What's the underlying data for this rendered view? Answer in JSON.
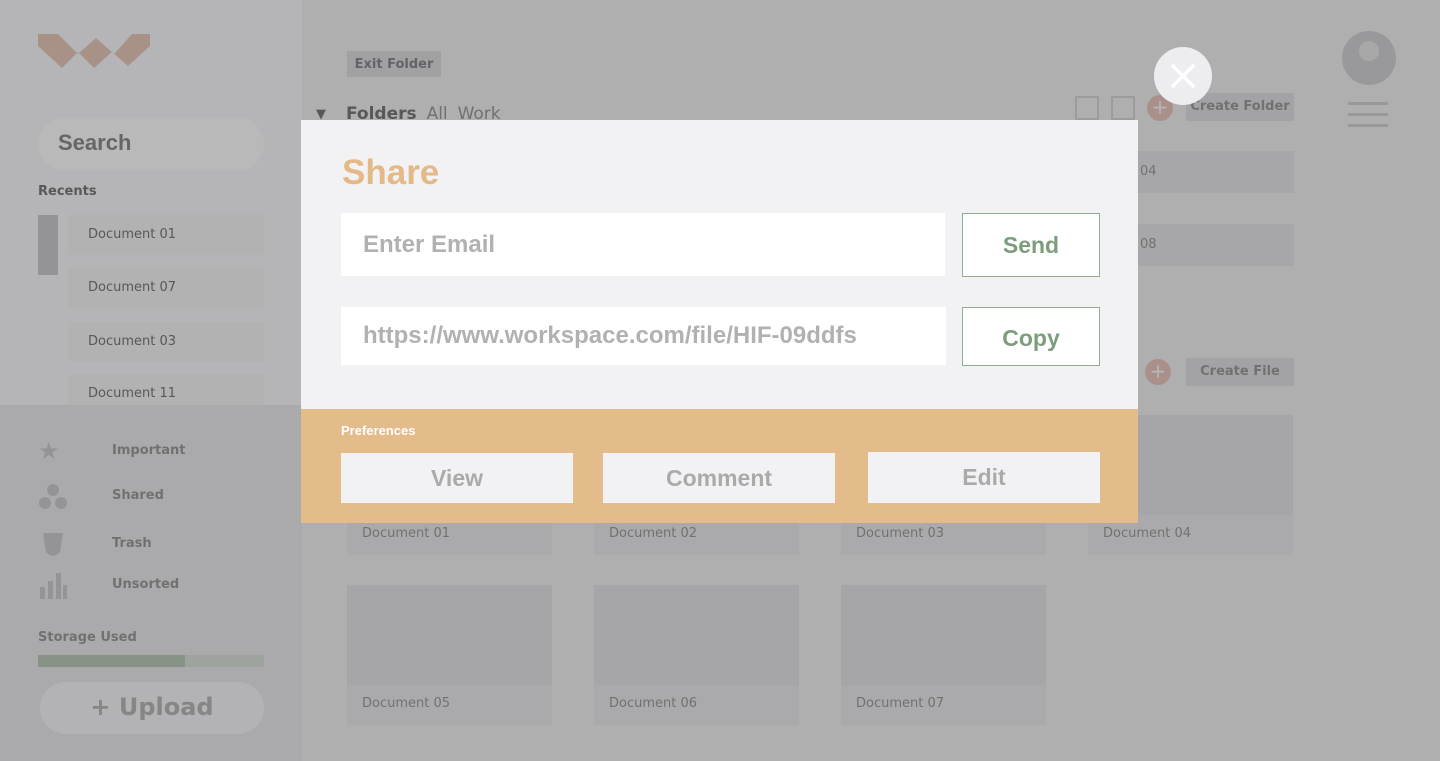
{
  "app": {
    "search_placeholder": "Search",
    "recents_label": "Recents",
    "recents": [
      "Document 01",
      "Document 07",
      "Document 03",
      "Document 11"
    ],
    "nav": [
      {
        "label": "Important",
        "icon": "star-icon"
      },
      {
        "label": "Shared",
        "icon": "shared-icon"
      },
      {
        "label": "Trash",
        "icon": "trash-icon"
      },
      {
        "label": "Unsorted",
        "icon": "unsorted-icon"
      }
    ],
    "storage_label": "Storage Used",
    "storage_fraction": 0.65,
    "upload_label": "Upload",
    "exit_folder_label": "Exit Folder",
    "folders_heading": "Folders",
    "folder_tabs": [
      "All",
      "Work"
    ],
    "create_folder_label": "Create Folder",
    "create_file_label": "Create File",
    "folder_rows": [
      "04",
      "08"
    ],
    "files": [
      "Document 01",
      "Document 02",
      "Document 03",
      "Document 04",
      "Document 05",
      "Document 06",
      "Document 07"
    ]
  },
  "share": {
    "title": "Share",
    "email_placeholder": "Enter Email",
    "send_label": "Send",
    "link_value": "https://www.workspace.com/file/HIF-09ddfs",
    "copy_label": "Copy",
    "preferences_label": "Preferences",
    "options": [
      "View",
      "Comment",
      "Edit"
    ]
  },
  "colors": {
    "accent_orange": "#e4bb8a",
    "title_orange": "#e5b887",
    "button_green": "#7c9e7c"
  }
}
